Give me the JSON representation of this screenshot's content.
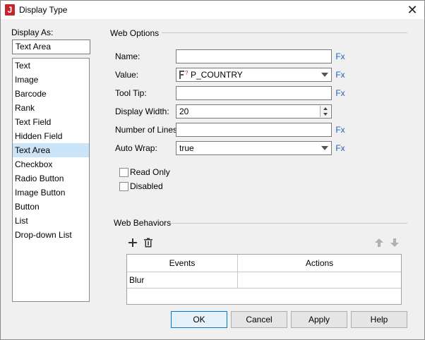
{
  "window": {
    "title": "Display Type",
    "app_icon_letter": "J",
    "close_glyph": "✕"
  },
  "display_as": {
    "label": "Display As:",
    "value": "Text Area",
    "items": [
      "Text",
      "Image",
      "Barcode",
      "Rank",
      "Text Field",
      "Hidden Field",
      "Text Area",
      "Checkbox",
      "Radio Button",
      "Image Button",
      "Button",
      "List",
      "Drop-down List"
    ],
    "selected": "Text Area"
  },
  "web_options": {
    "title": "Web Options",
    "name_label": "Name:",
    "name_value": "",
    "value_label": "Value:",
    "value_value": "P_COUNTRY",
    "tooltip_label": "Tool Tip:",
    "tooltip_value": "",
    "display_width_label": "Display Width:",
    "display_width_value": "20",
    "lines_label": "Number of Lines:",
    "lines_value": "",
    "autowrap_label": "Auto Wrap:",
    "autowrap_value": "true",
    "fx_label": "Fx",
    "read_only_label": "Read Only",
    "disabled_label": "Disabled"
  },
  "web_behaviors": {
    "title": "Web Behaviors",
    "columns": [
      "Events",
      "Actions"
    ],
    "rows": [
      {
        "event": "Blur",
        "action": ""
      }
    ]
  },
  "buttons": {
    "ok": "OK",
    "cancel": "Cancel",
    "apply": "Apply",
    "help": "Help"
  },
  "icons": {
    "add": "plus-icon",
    "delete": "trash-icon",
    "up": "arrow-up-icon",
    "down": "arrow-down-icon",
    "parameter": "parameter-icon"
  },
  "colors": {
    "accent": "#0078d7",
    "fx": "#1f5fbf",
    "selection": "#cce4f7",
    "brand": "#c4262e"
  }
}
